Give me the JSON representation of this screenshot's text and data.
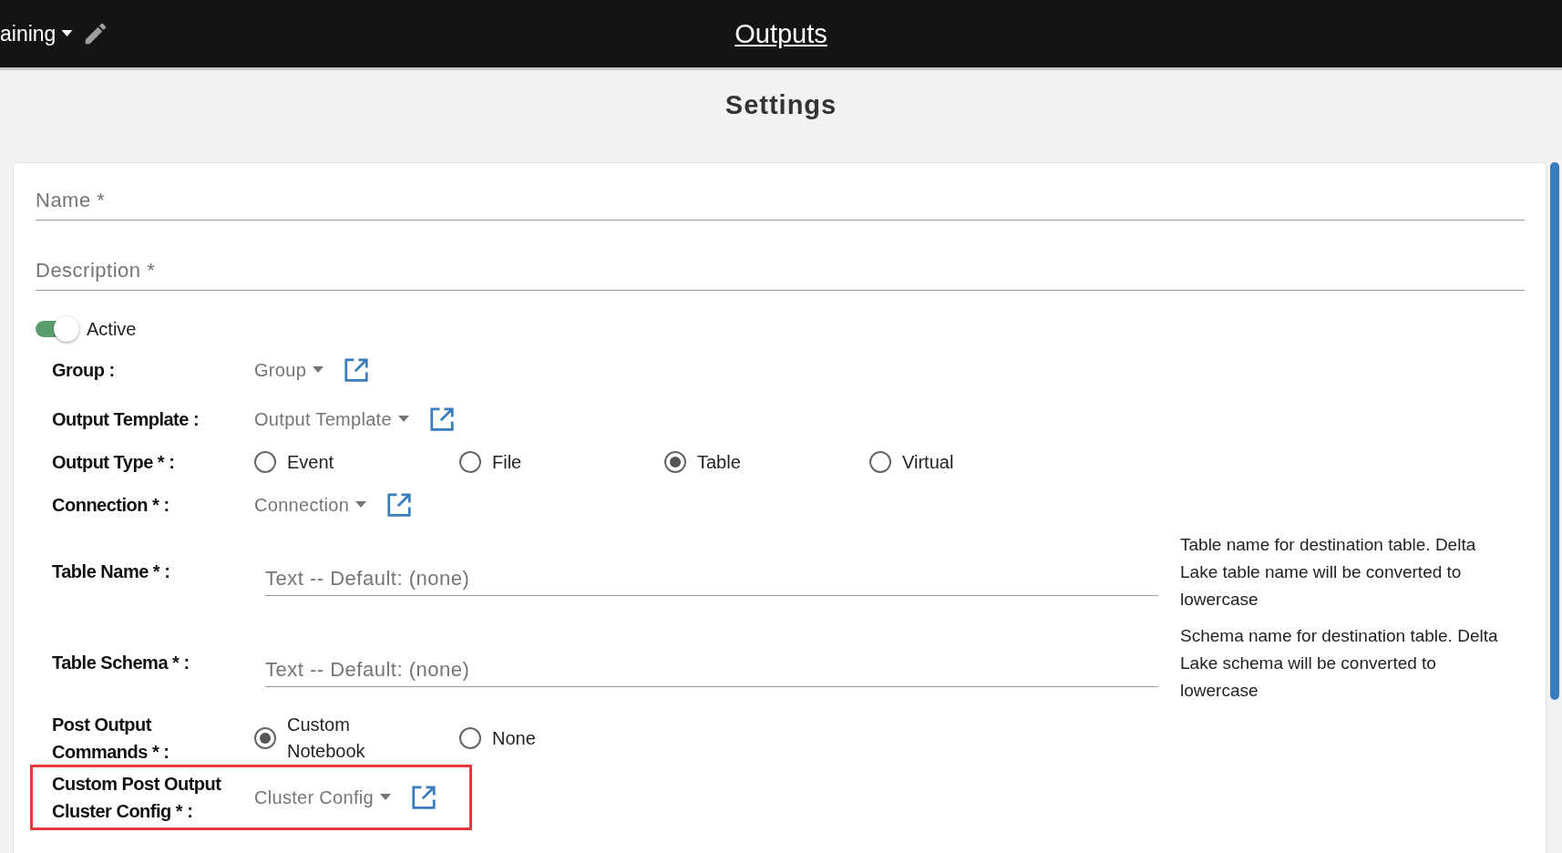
{
  "header": {
    "breadcrumb": "aining",
    "title": "Outputs"
  },
  "page_title": "Settings",
  "top_fields": [
    {
      "placeholder": "Name *"
    },
    {
      "placeholder": "Description *"
    }
  ],
  "active": {
    "label": "Active",
    "on": true
  },
  "rows": [
    {
      "kind": "select",
      "label": "Group :",
      "value": "Group",
      "highlighted": false
    },
    {
      "kind": "select",
      "label": "Output Template :",
      "value": "Output Template",
      "highlighted": false
    },
    {
      "kind": "radio",
      "label": "Output Type * :",
      "options": [
        {
          "label": "Event",
          "selected": false
        },
        {
          "label": "File",
          "selected": false
        },
        {
          "label": "Table",
          "selected": true
        },
        {
          "label": "Virtual",
          "selected": false
        }
      ]
    },
    {
      "kind": "select",
      "label": "Connection * :",
      "value": "Connection",
      "highlighted": false
    },
    {
      "kind": "text",
      "label": "Table Name * :",
      "placeholder": "Text -- Default: (none)",
      "help": "Table name for destination table. Delta Lake table name will be converted to lowercase"
    },
    {
      "kind": "text",
      "label": "Table Schema * :",
      "placeholder": "Text -- Default: (none)",
      "help": "Schema name for destination table. Delta Lake schema will be converted to lowercase"
    },
    {
      "kind": "radio",
      "label": "Post Output Commands * :",
      "options": [
        {
          "label": "Custom Notebook",
          "selected": true
        },
        {
          "label": "None",
          "selected": false
        }
      ]
    },
    {
      "kind": "select",
      "label": "Custom Post Output Cluster Config * :",
      "value": "Cluster Config",
      "highlighted": true
    }
  ]
}
